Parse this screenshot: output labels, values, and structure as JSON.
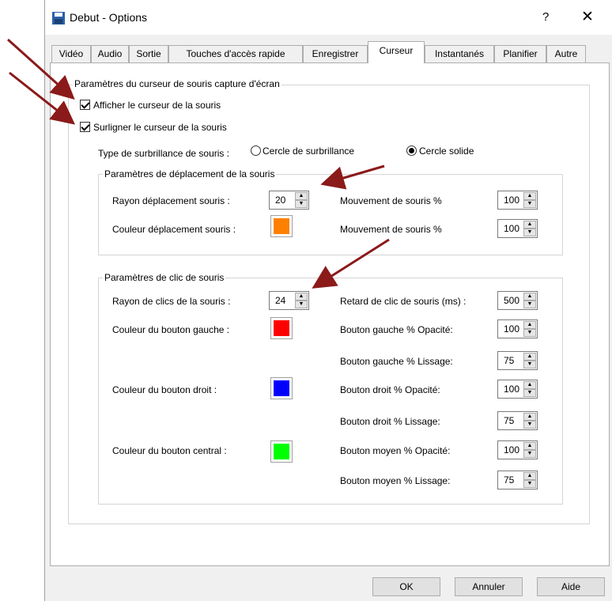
{
  "window": {
    "title": "Debut - Options",
    "help_label": "?",
    "close_label": "✕"
  },
  "tabs": [
    {
      "label": "Vidéo"
    },
    {
      "label": "Audio"
    },
    {
      "label": "Sortie"
    },
    {
      "label": "Touches d'accès rapide"
    },
    {
      "label": "Enregistrer"
    },
    {
      "label": "Curseur",
      "active": true
    },
    {
      "label": "Instantanés"
    },
    {
      "label": "Planifier"
    },
    {
      "label": "Autre"
    }
  ],
  "capture": {
    "group_title": "Paramètres du curseur de souris capture d'écran",
    "show_cursor": "Afficher le curseur de la souris",
    "highlight_cursor": "Surligner le curseur de la souris",
    "highlight_type_label": "Type de surbrillance de souris :",
    "radio_circle": "Cercle de surbrillance",
    "radio_solid": "Cercle solide",
    "selected": "Cercle solide"
  },
  "movement": {
    "group_title": "Paramètres de déplacement de la souris",
    "radius_label": "Rayon déplacement souris :",
    "radius_value": "20",
    "color_label": "Couleur déplacement souris :",
    "color": "#ff8000",
    "opacity_label": "Mouvement de souris %",
    "opacity_value": "100",
    "smooth_label": "Mouvement de souris %",
    "smooth_value": "100"
  },
  "click": {
    "group_title": "Paramètres de clic de souris",
    "radius_label": "Rayon de clics de la souris :",
    "radius_value": "24",
    "delay_label": "Retard de clic de souris (ms) :",
    "delay_value": "500",
    "left_color_label": "Couleur du bouton gauche :",
    "left_color": "#ff0000",
    "left_opacity_label": "Bouton gauche % Opacité:",
    "left_opacity_value": "100",
    "left_smooth_label": "Bouton gauche % Lissage:",
    "left_smooth_value": "75",
    "right_color_label": "Couleur du bouton droit :",
    "right_color": "#0000ff",
    "right_opacity_label": "Bouton droit % Opacité:",
    "right_opacity_value": "100",
    "right_smooth_label": "Bouton droit % Lissage:",
    "right_smooth_value": "75",
    "middle_color_label": "Couleur du bouton central :",
    "middle_color": "#00ff00",
    "middle_opacity_label": "Bouton moyen % Opacité:",
    "middle_opacity_value": "100",
    "middle_smooth_label": "Bouton moyen % Lissage:",
    "middle_smooth_value": "75"
  },
  "buttons": {
    "ok": "OK",
    "cancel": "Annuler",
    "help": "Aide"
  },
  "annotation_color": "#8b1a1a"
}
